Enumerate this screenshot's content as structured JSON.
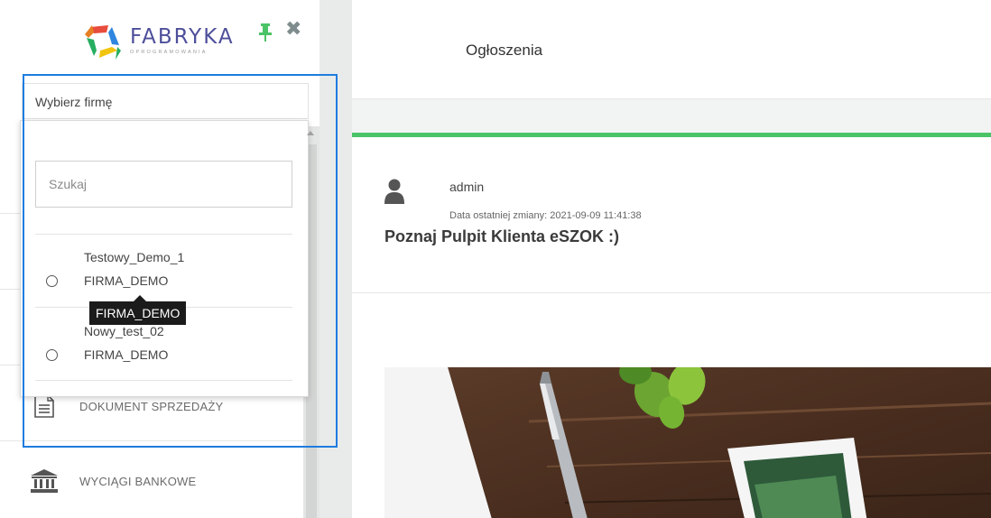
{
  "sidebar": {
    "logo": {
      "name": "FABRYKA",
      "sub": "OPROGRAMOWANIA"
    },
    "pin_icon": "pin-icon",
    "close_icon": "close-icon",
    "company_select": {
      "label": "Wybierz firmę"
    },
    "dropdown": {
      "search_placeholder": "Szukaj",
      "options": [
        {
          "name": "Testowy_Demo_1",
          "firm": "FIRMA_DEMO",
          "selected": false
        },
        {
          "name": "Nowy_test_02",
          "firm": "FIRMA_DEMO",
          "selected": false
        }
      ],
      "tooltip": "FIRMA_DEMO"
    },
    "menu": [
      {
        "label": "DOKUMENT SPRZEDAŻY",
        "icon": "document-icon"
      },
      {
        "label": "WYCIĄGI BANKOWE",
        "icon": "bank-icon"
      }
    ]
  },
  "header": {
    "title": "Ogłoszenia"
  },
  "post": {
    "author": "admin",
    "modified": "Data ostatniej zmiany: 2021-09-09 11:41:38",
    "title": "Poznaj Pulpit Klienta eSZOK :)",
    "avatar_icon": "user-icon"
  },
  "colors": {
    "accent_green": "#4bc367",
    "highlight_blue": "#1e7ddf",
    "logo_text": "#4d4f9a"
  }
}
